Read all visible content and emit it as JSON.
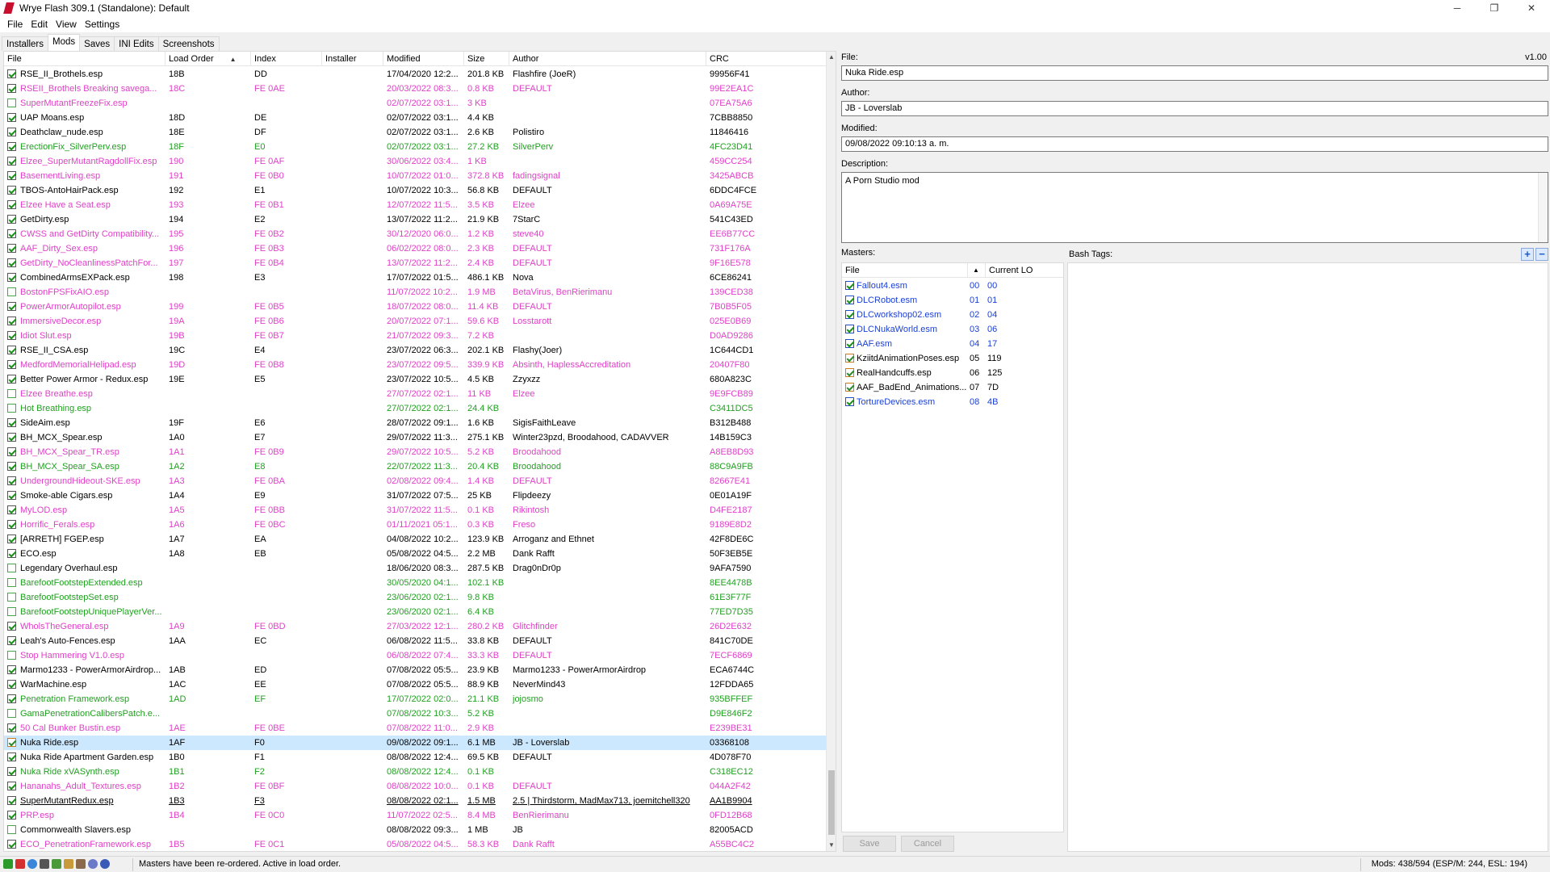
{
  "window": {
    "title": "Wrye Flash 309.1 (Standalone): Default",
    "controls": {
      "minimize": "─",
      "maximize": "❐",
      "close": "✕"
    }
  },
  "menu": [
    "File",
    "Edit",
    "View",
    "Settings"
  ],
  "tabs": [
    {
      "label": "Installers",
      "active": false
    },
    {
      "label": "Mods",
      "active": true
    },
    {
      "label": "Saves",
      "active": false
    },
    {
      "label": "INI Edits",
      "active": false
    },
    {
      "label": "Screenshots",
      "active": false
    }
  ],
  "mods_list": {
    "columns": [
      "File",
      "Load Order",
      "Index",
      "Installer",
      "Modified",
      "Size",
      "Author",
      "CRC"
    ],
    "sort_indicator": "▲",
    "rows": [
      {
        "file": "RSE_II_Brothels.esp",
        "lo": "18B",
        "idx": "DD",
        "mod": "17/04/2020 12:2...",
        "size": "201.8 KB",
        "author": "Flashfire (JoeR)",
        "crc": "99956F41",
        "c": "black",
        "cb": "on"
      },
      {
        "file": "RSEII_Brothels Breaking savega...",
        "lo": "18C",
        "idx": "FE 0AE",
        "mod": "20/03/2022 08:3...",
        "size": "0.8 KB",
        "author": "DEFAULT",
        "crc": "99E2EA1C",
        "c": "magenta",
        "cb": "on"
      },
      {
        "file": "SuperMutantFreezeFix.esp",
        "lo": "",
        "idx": "",
        "mod": "02/07/2022 03:1...",
        "size": "3 KB",
        "author": "",
        "crc": "07EA75A6",
        "c": "magenta",
        "cb": "off"
      },
      {
        "file": "UAP Moans.esp",
        "lo": "18D",
        "idx": "DE",
        "mod": "02/07/2022 03:1...",
        "size": "4.4 KB",
        "author": "",
        "crc": "7CBB8850",
        "c": "black",
        "cb": "on"
      },
      {
        "file": "Deathclaw_nude.esp",
        "lo": "18E",
        "idx": "DF",
        "mod": "02/07/2022 03:1...",
        "size": "2.6 KB",
        "author": "Polistiro",
        "crc": "11846416",
        "c": "black",
        "cb": "on"
      },
      {
        "file": "ErectionFix_SilverPerv.esp",
        "lo": "18F",
        "idx": "E0",
        "mod": "02/07/2022 03:1...",
        "size": "27.2 KB",
        "author": "SilverPerv",
        "crc": "4FC23D41",
        "c": "green",
        "cb": "on"
      },
      {
        "file": "Elzee_SuperMutantRagdollFix.esp",
        "lo": "190",
        "idx": "FE 0AF",
        "mod": "30/06/2022 03:4...",
        "size": "1 KB",
        "author": "",
        "crc": "459CC254",
        "c": "magenta",
        "cb": "on"
      },
      {
        "file": "BasementLiving.esp",
        "lo": "191",
        "idx": "FE 0B0",
        "mod": "10/07/2022 01:0...",
        "size": "372.8 KB",
        "author": "fadingsignal",
        "crc": "3425ABCB",
        "c": "magenta",
        "cb": "on"
      },
      {
        "file": "TBOS-AntoHairPack.esp",
        "lo": "192",
        "idx": "E1",
        "mod": "10/07/2022 10:3...",
        "size": "56.8 KB",
        "author": "DEFAULT",
        "crc": "6DDC4FCE",
        "c": "black",
        "cb": "on"
      },
      {
        "file": "Elzee Have a Seat.esp",
        "lo": "193",
        "idx": "FE 0B1",
        "mod": "12/07/2022 11:5...",
        "size": "3.5 KB",
        "author": "Elzee",
        "crc": "0A69A75E",
        "c": "magenta",
        "cb": "on"
      },
      {
        "file": "GetDirty.esp",
        "lo": "194",
        "idx": "E2",
        "mod": "13/07/2022 11:2...",
        "size": "21.9 KB",
        "author": "7StarC",
        "crc": "541C43ED",
        "c": "black",
        "cb": "on"
      },
      {
        "file": "CWSS and GetDirty Compatibility...",
        "lo": "195",
        "idx": "FE 0B2",
        "mod": "30/12/2020 06:0...",
        "size": "1.2 KB",
        "author": "steve40",
        "crc": "EE6B77CC",
        "c": "magenta",
        "cb": "on"
      },
      {
        "file": "AAF_Dirty_Sex.esp",
        "lo": "196",
        "idx": "FE 0B3",
        "mod": "06/02/2022 08:0...",
        "size": "2.3 KB",
        "author": "DEFAULT",
        "crc": "731F176A",
        "c": "magenta",
        "cb": "on"
      },
      {
        "file": "GetDirty_NoCleanlinessPatchFor...",
        "lo": "197",
        "idx": "FE 0B4",
        "mod": "13/07/2022 11:2...",
        "size": "2.4 KB",
        "author": "DEFAULT",
        "crc": "9F16E578",
        "c": "magenta",
        "cb": "on"
      },
      {
        "file": "CombinedArmsEXPack.esp",
        "lo": "198",
        "idx": "E3",
        "mod": "17/07/2022 01:5...",
        "size": "486.1 KB",
        "author": "Nova",
        "crc": "6CE86241",
        "c": "black",
        "cb": "on"
      },
      {
        "file": "BostonFPSFixAIO.esp",
        "lo": "",
        "idx": "",
        "mod": "11/07/2022 10:2...",
        "size": "1.9 MB",
        "author": "BetaVirus, BenRierimanu",
        "crc": "139CED38",
        "c": "magenta",
        "cb": "off"
      },
      {
        "file": "PowerArmorAutopilot.esp",
        "lo": "199",
        "idx": "FE 0B5",
        "mod": "18/07/2022 08:0...",
        "size": "11.4 KB",
        "author": "DEFAULT",
        "crc": "7B0B5F05",
        "c": "magenta",
        "cb": "on"
      },
      {
        "file": "ImmersiveDecor.esp",
        "lo": "19A",
        "idx": "FE 0B6",
        "mod": "20/07/2022 07:1...",
        "size": "59.6 KB",
        "author": "Losstarott",
        "crc": "025E0B69",
        "c": "magenta",
        "cb": "on"
      },
      {
        "file": "Idiot Slut.esp",
        "lo": "19B",
        "idx": "FE 0B7",
        "mod": "21/07/2022 09:3...",
        "size": "7.2 KB",
        "author": "",
        "crc": "D0AD9286",
        "c": "magenta",
        "cb": "on"
      },
      {
        "file": "RSE_II_CSA.esp",
        "lo": "19C",
        "idx": "E4",
        "mod": "23/07/2022 06:3...",
        "size": "202.1 KB",
        "author": "Flashy(Joer)",
        "crc": "1C644CD1",
        "c": "black",
        "cb": "on"
      },
      {
        "file": "MedfordMemorialHelipad.esp",
        "lo": "19D",
        "idx": "FE 0B8",
        "mod": "23/07/2022 09:5...",
        "size": "339.9 KB",
        "author": "Absinth, HaplessAccreditation",
        "crc": "20407F80",
        "c": "magenta",
        "cb": "on"
      },
      {
        "file": "Better Power Armor - Redux.esp",
        "lo": "19E",
        "idx": "E5",
        "mod": "23/07/2022 10:5...",
        "size": "4.5 KB",
        "author": "Zzyxzz",
        "crc": "680A823C",
        "c": "black",
        "cb": "on"
      },
      {
        "file": "Elzee Breathe.esp",
        "lo": "",
        "idx": "",
        "mod": "27/07/2022 02:1...",
        "size": "11 KB",
        "author": "Elzee",
        "crc": "9E9FCB89",
        "c": "magenta",
        "cb": "off"
      },
      {
        "file": "Hot Breathing.esp",
        "lo": "",
        "idx": "",
        "mod": "27/07/2022 02:1...",
        "size": "24.4 KB",
        "author": "",
        "crc": "C3411DC5",
        "c": "green",
        "cb": "off"
      },
      {
        "file": "SideAim.esp",
        "lo": "19F",
        "idx": "E6",
        "mod": "28/07/2022 09:1...",
        "size": "1.6 KB",
        "author": "SigisFaithLeave",
        "crc": "B312B488",
        "c": "black",
        "cb": "on"
      },
      {
        "file": "BH_MCX_Spear.esp",
        "lo": "1A0",
        "idx": "E7",
        "mod": "29/07/2022 11:3...",
        "size": "275.1 KB",
        "author": "Winter23pzd, Broodahood, CADAVVER",
        "crc": "14B159C3",
        "c": "black",
        "cb": "on"
      },
      {
        "file": "BH_MCX_Spear_TR.esp",
        "lo": "1A1",
        "idx": "FE 0B9",
        "mod": "29/07/2022 10:5...",
        "size": "5.2 KB",
        "author": "Broodahood",
        "crc": "A8EB8D93",
        "c": "magenta",
        "cb": "on"
      },
      {
        "file": "BH_MCX_Spear_SA.esp",
        "lo": "1A2",
        "idx": "E8",
        "mod": "22/07/2022 11:3...",
        "size": "20.4 KB",
        "author": "Broodahood",
        "crc": "88C9A9FB",
        "c": "green",
        "cb": "on"
      },
      {
        "file": "UndergroundHideout-SKE.esp",
        "lo": "1A3",
        "idx": "FE 0BA",
        "mod": "02/08/2022 09:4...",
        "size": "1.4 KB",
        "author": "DEFAULT",
        "crc": "82667E41",
        "c": "magenta",
        "cb": "on"
      },
      {
        "file": "Smoke-able Cigars.esp",
        "lo": "1A4",
        "idx": "E9",
        "mod": "31/07/2022 07:5...",
        "size": "25 KB",
        "author": "Flipdeezy",
        "crc": "0E01A19F",
        "c": "black",
        "cb": "on"
      },
      {
        "file": "MyLOD.esp",
        "lo": "1A5",
        "idx": "FE 0BB",
        "mod": "31/07/2022 11:5...",
        "size": "0.1 KB",
        "author": "Rikintosh",
        "crc": "D4FE2187",
        "c": "magenta",
        "cb": "on"
      },
      {
        "file": "Horrific_Ferals.esp",
        "lo": "1A6",
        "idx": "FE 0BC",
        "mod": "01/11/2021 05:1...",
        "size": "0.3 KB",
        "author": "Freso",
        "crc": "9189E8D2",
        "c": "magenta",
        "cb": "on"
      },
      {
        "file": "[ARRETH] FGEP.esp",
        "lo": "1A7",
        "idx": "EA",
        "mod": "04/08/2022 10:2...",
        "size": "123.9 KB",
        "author": "Arroganz and Ethnet",
        "crc": "42F8DE6C",
        "c": "black",
        "cb": "on"
      },
      {
        "file": "ECO.esp",
        "lo": "1A8",
        "idx": "EB",
        "mod": "05/08/2022 04:5...",
        "size": "2.2 MB",
        "author": "Dank Rafft",
        "crc": "50F3EB5E",
        "c": "black",
        "cb": "on"
      },
      {
        "file": "Legendary Overhaul.esp",
        "lo": "",
        "idx": "",
        "mod": "18/06/2020 08:3...",
        "size": "287.5 KB",
        "author": "Drag0nDr0p",
        "crc": "9AFA7590",
        "c": "black",
        "cb": "off"
      },
      {
        "file": "BarefootFootstepExtended.esp",
        "lo": "",
        "idx": "",
        "mod": "30/05/2020 04:1...",
        "size": "102.1 KB",
        "author": "",
        "crc": "8EE4478B",
        "c": "green",
        "cb": "off"
      },
      {
        "file": "BarefootFootstepSet.esp",
        "lo": "",
        "idx": "",
        "mod": "23/06/2020 02:1...",
        "size": "9.8 KB",
        "author": "",
        "crc": "61E3F77F",
        "c": "green",
        "cb": "off"
      },
      {
        "file": "BarefootFootstepUniquePlayerVer...",
        "lo": "",
        "idx": "",
        "mod": "23/06/2020 02:1...",
        "size": "6.4 KB",
        "author": "",
        "crc": "77ED7D35",
        "c": "green",
        "cb": "off"
      },
      {
        "file": "WholsTheGeneral.esp",
        "lo": "1A9",
        "idx": "FE 0BD",
        "mod": "27/03/2022 12:1...",
        "size": "280.2 KB",
        "author": "Glitchfinder",
        "crc": "26D2E632",
        "c": "magenta",
        "cb": "on"
      },
      {
        "file": "Leah's Auto-Fences.esp",
        "lo": "1AA",
        "idx": "EC",
        "mod": "06/08/2022 11:5...",
        "size": "33.8 KB",
        "author": "DEFAULT",
        "crc": "841C70DE",
        "c": "black",
        "cb": "on"
      },
      {
        "file": "Stop Hammering V1.0.esp",
        "lo": "",
        "idx": "",
        "mod": "06/08/2022 07:4...",
        "size": "33.3 KB",
        "author": "DEFAULT",
        "crc": "7ECF6869",
        "c": "magenta",
        "cb": "off"
      },
      {
        "file": "Marmo1233 - PowerArmorAirdrop...",
        "lo": "1AB",
        "idx": "ED",
        "mod": "07/08/2022 05:5...",
        "size": "23.9 KB",
        "author": "Marmo1233 - PowerArmorAirdrop",
        "crc": "ECA6744C",
        "c": "black",
        "cb": "on"
      },
      {
        "file": "WarMachine.esp",
        "lo": "1AC",
        "idx": "EE",
        "mod": "07/08/2022 05:5...",
        "size": "88.9 KB",
        "author": "NeverMind43",
        "crc": "12FDDA65",
        "c": "black",
        "cb": "on"
      },
      {
        "file": "Penetration Framework.esp",
        "lo": "1AD",
        "idx": "EF",
        "mod": "17/07/2022 02:0...",
        "size": "21.1 KB",
        "author": "jojosmo",
        "crc": "935BFFEF",
        "c": "green",
        "cb": "on"
      },
      {
        "file": "GamaPenetrationCalibersPatch.e...",
        "lo": "",
        "idx": "",
        "mod": "07/08/2022 10:3...",
        "size": "5.2 KB",
        "author": "",
        "crc": "D9E846F2",
        "c": "green",
        "cb": "off"
      },
      {
        "file": "50 Cal Bunker Bustin.esp",
        "lo": "1AE",
        "idx": "FE 0BE",
        "mod": "07/08/2022 11:0...",
        "size": "2.9 KB",
        "author": "",
        "crc": "E239BE31",
        "c": "magenta",
        "cb": "on"
      },
      {
        "file": "Nuka Ride.esp",
        "lo": "1AF",
        "idx": "F0",
        "mod": "09/08/2022 09:1...",
        "size": "6.1 MB",
        "author": "JB - Loverslab",
        "crc": "03368108",
        "c": "black",
        "cb": "orange-on",
        "sel": true
      },
      {
        "file": "Nuka Ride Apartment Garden.esp",
        "lo": "1B0",
        "idx": "F1",
        "mod": "08/08/2022 12:4...",
        "size": "69.5 KB",
        "author": "DEFAULT",
        "crc": "4D078F70",
        "c": "black",
        "cb": "on"
      },
      {
        "file": "Nuka Ride xVASynth.esp",
        "lo": "1B1",
        "idx": "F2",
        "mod": "08/08/2022 12:4...",
        "size": "0.1 KB",
        "author": "",
        "crc": "C318EC12",
        "c": "green",
        "cb": "on"
      },
      {
        "file": "Hananahs_Adult_Textures.esp",
        "lo": "1B2",
        "idx": "FE 0BF",
        "mod": "08/08/2022 10:0...",
        "size": "0.1 KB",
        "author": "DEFAULT",
        "crc": "044A2F42",
        "c": "magenta",
        "cb": "on"
      },
      {
        "file": "SuperMutantRedux.esp",
        "lo": "1B3",
        "idx": "F3",
        "mod": "08/08/2022 02:1...",
        "size": "1.5 MB",
        "author": "2.5 | Thirdstorm, MadMax713, joemitchell320",
        "crc": "AA1B9904",
        "c": "black",
        "cb": "on",
        "ul": true
      },
      {
        "file": "PRP.esp",
        "lo": "1B4",
        "idx": "FE 0C0",
        "mod": "11/07/2022 02:5...",
        "size": "8.4 MB",
        "author": "BenRierimanu",
        "crc": "0FD12B68",
        "c": "magenta",
        "cb": "on"
      },
      {
        "file": "Commonwealth Slavers.esp",
        "lo": "",
        "idx": "",
        "mod": "08/08/2022 09:3...",
        "size": "1 MB",
        "author": "JB",
        "crc": "82005ACD",
        "c": "black",
        "cb": "off"
      },
      {
        "file": "ECO_PenetrationFramework.esp",
        "lo": "1B5",
        "idx": "FE 0C1",
        "mod": "05/08/2022 04:5...",
        "size": "58.3 KB",
        "author": "Dank Rafft",
        "crc": "A55BC4C2",
        "c": "magenta",
        "cb": "on"
      }
    ]
  },
  "details": {
    "version": "v1.00",
    "file_label": "File:",
    "file_value": "Nuka Ride.esp",
    "author_label": "Author:",
    "author_value": "JB - Loverslab",
    "modified_label": "Modified:",
    "modified_value": "09/08/2022 09:10:13 a. m.",
    "description_label": "Description:",
    "description_value": "A Porn Studio mod",
    "masters_label": "Masters:",
    "bash_tags_label": "Bash Tags:",
    "masters_columns": [
      "File",
      "Current LO"
    ],
    "masters_sort_indicator": "▲",
    "masters": [
      {
        "file": "Fallout4.esm",
        "a": "00",
        "b": "00",
        "c": "blue"
      },
      {
        "file": "DLCRobot.esm",
        "a": "01",
        "b": "01",
        "c": "blue"
      },
      {
        "file": "DLCworkshop02.esm",
        "a": "02",
        "b": "04",
        "c": "blue"
      },
      {
        "file": "DLCNukaWorld.esm",
        "a": "03",
        "b": "06",
        "c": "blue"
      },
      {
        "file": "AAF.esm",
        "a": "04",
        "b": "17",
        "c": "blue"
      },
      {
        "file": "KziitdAnimationPoses.esp",
        "a": "05",
        "b": "119",
        "c": "black"
      },
      {
        "file": "RealHandcuffs.esp",
        "a": "06",
        "b": "125",
        "c": "black"
      },
      {
        "file": "AAF_BadEnd_Animations...",
        "a": "07",
        "b": "7D",
        "c": "black"
      },
      {
        "file": "TortureDevices.esm",
        "a": "08",
        "b": "4B",
        "c": "blue"
      }
    ],
    "tag_add": "+",
    "tag_remove": "−",
    "save_label": "Save",
    "cancel_label": "Cancel"
  },
  "status": {
    "message": "Masters have been re-ordered. Active in load order.",
    "counts": "Mods: 438/594 (ESP/M: 244, ESL: 194)"
  }
}
